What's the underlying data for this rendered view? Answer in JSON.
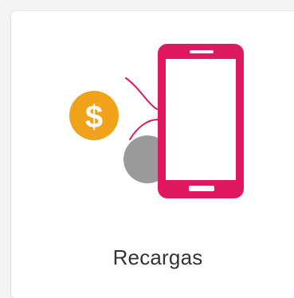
{
  "tile": {
    "label": "Recargas",
    "coin_symbol": "$"
  },
  "icons": {
    "illustration": "phone-recharge-icon",
    "coin": "dollar-coin-icon",
    "phone": "smartphone-icon",
    "hand": "hand-icon"
  },
  "colors": {
    "phone": "#e0185f",
    "coin": "#f0a21b",
    "hand": "#9a9a9a",
    "label": "#333333"
  }
}
